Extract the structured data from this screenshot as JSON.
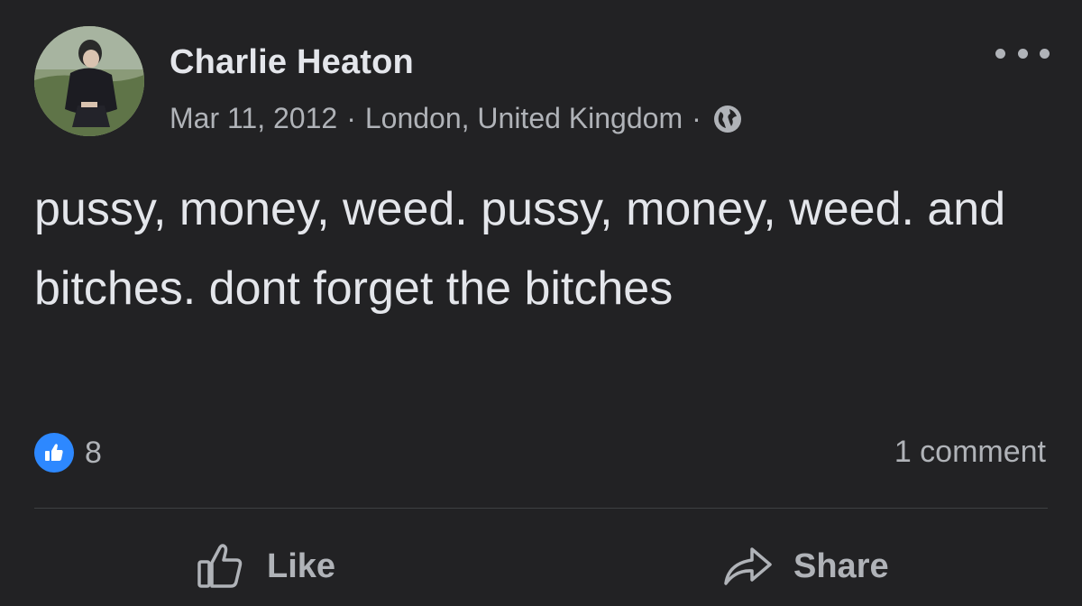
{
  "post": {
    "author": "Charlie Heaton",
    "date": "Mar 11, 2012",
    "separator": "·",
    "location": "London, United Kingdom",
    "privacy_icon": "globe-icon",
    "text": "pussy, money, weed. pussy, money, weed. and bitches. dont forget the bitches",
    "reaction_icon": "like-reaction-icon",
    "reaction_count": "8",
    "comment_count": "1 comment"
  },
  "actions": {
    "like_label": "Like",
    "share_label": "Share"
  },
  "colors": {
    "background": "#222224",
    "primary_text": "#e4e6eb",
    "secondary_text": "#b0b3b8",
    "like_blue": "#2d88ff",
    "divider": "#3e4042"
  }
}
